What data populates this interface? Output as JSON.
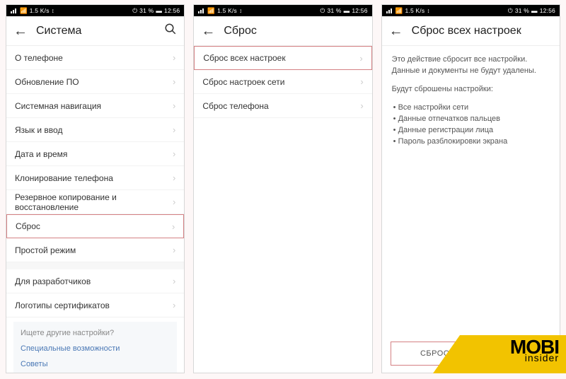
{
  "status": {
    "battery": "31 %",
    "time": "12:56",
    "speed": "1.5 K/s"
  },
  "screen1": {
    "title": "Система",
    "items": [
      "О телефоне",
      "Обновление ПО",
      "Системная навигация",
      "Язык и ввод",
      "Дата и время",
      "Клонирование телефона",
      "Резервное копирование и восстановление",
      "Сброс",
      "Простой режим",
      "Для разработчиков",
      "Логотипы сертификатов"
    ],
    "highlight_index": 7,
    "suggest": {
      "heading": "Ищете другие настройки?",
      "links": [
        "Специальные возможности",
        "Советы"
      ]
    }
  },
  "screen2": {
    "title": "Сброс",
    "items": [
      "Сброс всех настроек",
      "Сброс настроек сети",
      "Сброс телефона"
    ],
    "highlight_index": 0
  },
  "screen3": {
    "title": "Сброс всех настроек",
    "para1": "Это действие сбросит все настройки. Данные и документы не будут удалены.",
    "para2": "Будут сброшены настройки:",
    "bullets": [
      "Все настройки сети",
      "Данные отпечатков пальцев",
      "Данные регистрации лица",
      "Пароль разблокировки экрана"
    ],
    "button": "СБРОС ВСЕХ НАСТРОЕК"
  },
  "watermark": {
    "brand_top": "MOBI",
    "brand_bottom": "insider"
  }
}
